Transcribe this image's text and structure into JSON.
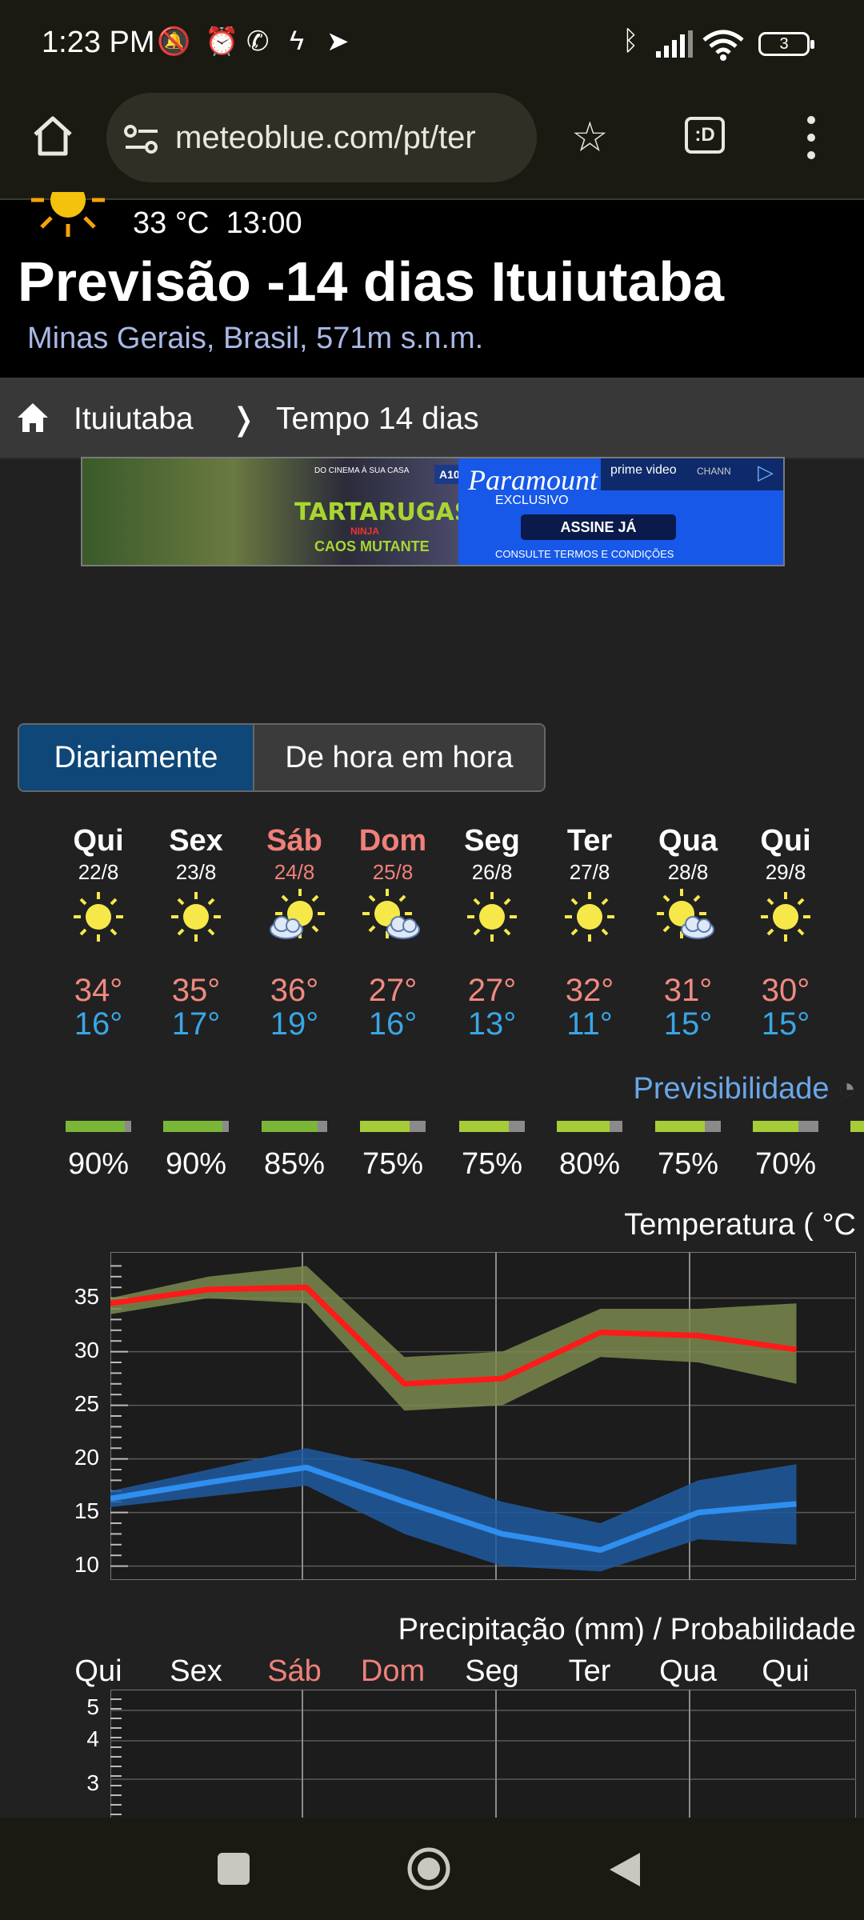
{
  "status_bar": {
    "time": "1:23 PM",
    "battery": "3"
  },
  "browser": {
    "url": "meteoblue.com/pt/ter",
    "tab_switcher": ":D"
  },
  "header": {
    "current_temp": "33 °C",
    "current_time": "13:00",
    "title": "Previsão -14 dias Ituiutaba",
    "subtitle": "Minas Gerais, Brasil, 571m s.n.m."
  },
  "breadcrumb": {
    "items": [
      "Ituiutaba",
      "Tempo 14 dias"
    ],
    "separator": "❭"
  },
  "ad": {
    "badge": "A10",
    "brand": "Paramount+",
    "exclusive": "EXCLUSIVO",
    "prime": "prime video",
    "channels": "CHANN",
    "cta": "ASSINE JÁ",
    "terms": "CONSULTE TERMOS E CONDIÇÕES",
    "movie": "TARTARUGAS",
    "movie_sub": "NINJA",
    "movie_tag": "CAOS MUTANTE",
    "cinema": "DO CINEMA À SUA CASA"
  },
  "tabs": {
    "daily": "Diariamente",
    "hourly": "De hora em hora"
  },
  "days": [
    {
      "name": "Qui",
      "date": "22/8",
      "weekend": false,
      "icon": "sun-icon",
      "max": "34°",
      "min": "16°",
      "predictability": "90%",
      "pred_value": 0.9
    },
    {
      "name": "Sex",
      "date": "23/8",
      "weekend": false,
      "icon": "sun-icon",
      "max": "35°",
      "min": "17°",
      "predictability": "90%",
      "pred_value": 0.9
    },
    {
      "name": "Sáb",
      "date": "24/8",
      "weekend": true,
      "icon": "sun-cloud-icon",
      "max": "36°",
      "min": "19°",
      "predictability": "85%",
      "pred_value": 0.85
    },
    {
      "name": "Dom",
      "date": "25/8",
      "weekend": true,
      "icon": "sun-cloud-icon",
      "max": "27°",
      "min": "16°",
      "predictability": "75%",
      "pred_value": 0.75
    },
    {
      "name": "Seg",
      "date": "26/8",
      "weekend": false,
      "icon": "sun-icon",
      "max": "27°",
      "min": "13°",
      "predictability": "75%",
      "pred_value": 0.75
    },
    {
      "name": "Ter",
      "date": "27/8",
      "weekend": false,
      "icon": "sun-icon",
      "max": "32°",
      "min": "11°",
      "predictability": "80%",
      "pred_value": 0.8
    },
    {
      "name": "Qua",
      "date": "28/8",
      "weekend": false,
      "icon": "sun-cloud-icon",
      "max": "31°",
      "min": "15°",
      "predictability": "75%",
      "pred_value": 0.75
    },
    {
      "name": "Qui",
      "date": "29/8",
      "weekend": false,
      "icon": "sun-icon",
      "max": "30°",
      "min": "15°",
      "predictability": "70%",
      "pred_value": 0.7
    }
  ],
  "predictability_label": "Previsibilidade",
  "colors": {
    "max_line": "#ff1a1a",
    "max_band": "#7a8a4e",
    "min_line": "#2f8ff0",
    "min_band": "#1e5aa0",
    "weekend": "#f0807a"
  },
  "chart_data": [
    {
      "type": "line",
      "title": "Temperatura ( °C",
      "categories": [
        "Qui",
        "Sex",
        "Sáb",
        "Dom",
        "Seg",
        "Ter",
        "Qua",
        "Qui"
      ],
      "yticks": [
        10,
        15,
        20,
        25,
        30,
        35
      ],
      "ylim": [
        9,
        39
      ],
      "grid": true,
      "series": [
        {
          "values": [
            34.5,
            35.8,
            36,
            27,
            27.5,
            31.8,
            31.5,
            30.2
          ]
        },
        {
          "values": [
            16.3,
            17.8,
            19.2,
            16,
            13,
            11.5,
            15,
            15.8
          ]
        }
      ],
      "bands": [
        {
          "upper": [
            35,
            37,
            38,
            29.5,
            30,
            34,
            34,
            34.5
          ],
          "lower": [
            33.5,
            35,
            34.5,
            24.5,
            25,
            29.5,
            29,
            27
          ]
        },
        {
          "upper": [
            17,
            19,
            21,
            19,
            16,
            14,
            18,
            19.5
          ],
          "lower": [
            15.5,
            16.5,
            17.5,
            13,
            10,
            9.5,
            12.5,
            12
          ]
        }
      ]
    },
    {
      "type": "bar",
      "title": "Precipitação (mm) / Probabilidade",
      "categories": [
        "Qui",
        "Sex",
        "Sáb",
        "Dom",
        "Seg",
        "Ter",
        "Qua",
        "Qui"
      ],
      "yticks": [
        3,
        4,
        5
      ],
      "grid": true
    }
  ]
}
